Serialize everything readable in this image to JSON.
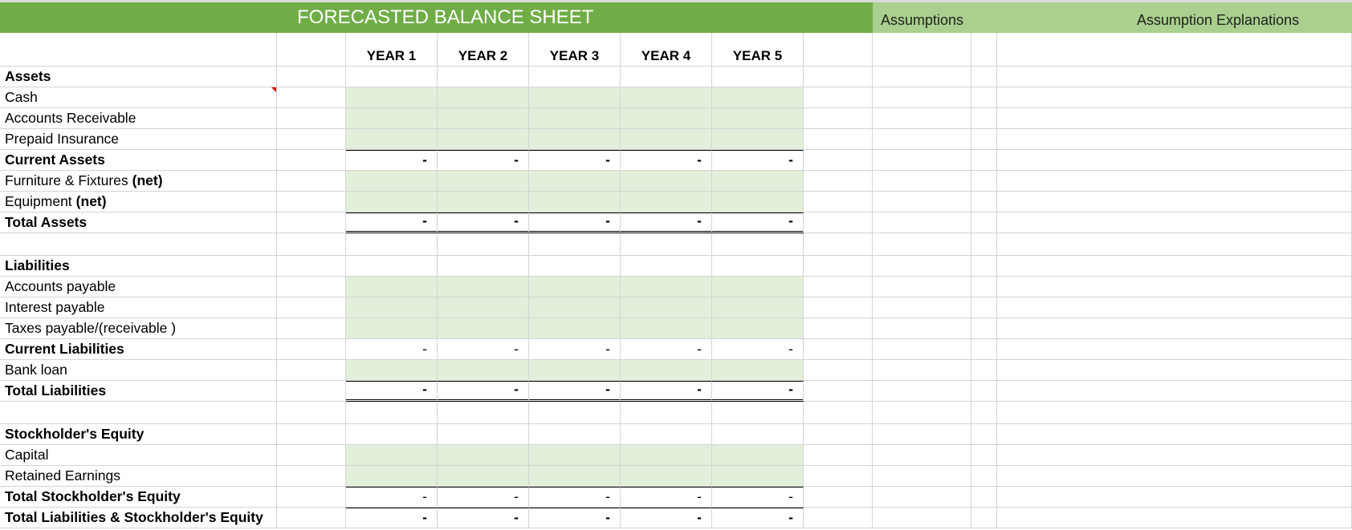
{
  "header": {
    "title": "FORECASTED BALANCE SHEET",
    "assumptions": "Assumptions",
    "assumption_explanations": "Assumption Explanations"
  },
  "years": [
    "YEAR 1",
    "YEAR 2",
    "YEAR 3",
    "YEAR 4",
    "YEAR 5"
  ],
  "rows": [
    {
      "label": "Assets",
      "type": "section"
    },
    {
      "label": "Cash",
      "type": "input"
    },
    {
      "label": "Accounts Receivable",
      "type": "input"
    },
    {
      "label": "Prepaid Insurance",
      "type": "input"
    },
    {
      "label": "Current Assets",
      "type": "subtotal",
      "values": [
        "-",
        "-",
        "-",
        "-",
        "-"
      ]
    },
    {
      "label": "Furniture & Fixtures",
      "suffix": "(net)",
      "type": "input"
    },
    {
      "label": "Equipment",
      "suffix": "(net)",
      "type": "input"
    },
    {
      "label": "Total Assets",
      "type": "total",
      "values": [
        "-",
        "-",
        "-",
        "-",
        "-"
      ]
    },
    {
      "label": "",
      "type": "blank"
    },
    {
      "label": "Liabilities",
      "type": "section"
    },
    {
      "label": "Accounts payable",
      "type": "input"
    },
    {
      "label": "Interest payable",
      "type": "input"
    },
    {
      "label": "Taxes payable/(receivable )",
      "type": "input"
    },
    {
      "label": "Current Liabilities",
      "type": "subtotal_light",
      "values": [
        "-",
        "-",
        "-",
        "-",
        "-"
      ]
    },
    {
      "label": "Bank loan",
      "type": "input"
    },
    {
      "label": "Total Liabilities",
      "type": "total",
      "values": [
        "-",
        "-",
        "-",
        "-",
        "-"
      ]
    },
    {
      "label": "",
      "type": "blank"
    },
    {
      "label": "Stockholder's Equity",
      "type": "section"
    },
    {
      "label": "Capital",
      "type": "input"
    },
    {
      "label": "Retained Earnings",
      "type": "input"
    },
    {
      "label": "Total Stockholder's Equity",
      "type": "subtotal_light_top",
      "values": [
        "-",
        "-",
        "-",
        "-",
        "-"
      ]
    },
    {
      "label": "Total Liabilities & Stockholder's Equity",
      "type": "grand",
      "values": [
        "-",
        "-",
        "-",
        "-",
        "-"
      ]
    }
  ],
  "colors": {
    "title_green": "#70ad47",
    "assumption_green": "#a9d08e",
    "input_fill": "#e2efda",
    "comment_marker": "#e00000"
  }
}
